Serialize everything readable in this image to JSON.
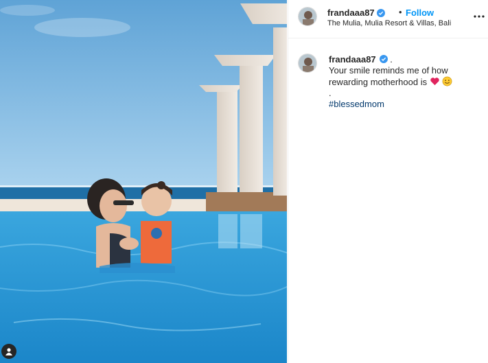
{
  "post": {
    "username": "frandaaa87",
    "follow_label": "Follow",
    "separator": "•",
    "location": "The Mulia, Mulia Resort & Villas, Bali",
    "caption": {
      "username": "frandaaa87",
      "after_badge": ".",
      "line1": "Your smile reminds me of how rewarding motherhood is",
      "line2": ".",
      "hashtag": "#blessedmom"
    }
  },
  "icons": {
    "verified": "verified-badge-icon",
    "more": "more-options-icon",
    "tag": "tagged-user-icon",
    "heart": "heart-emoji",
    "smile": "smile-emoji"
  },
  "colors": {
    "link_blue": "#0095f6",
    "hashtag": "#00376b",
    "text": "#262626"
  }
}
